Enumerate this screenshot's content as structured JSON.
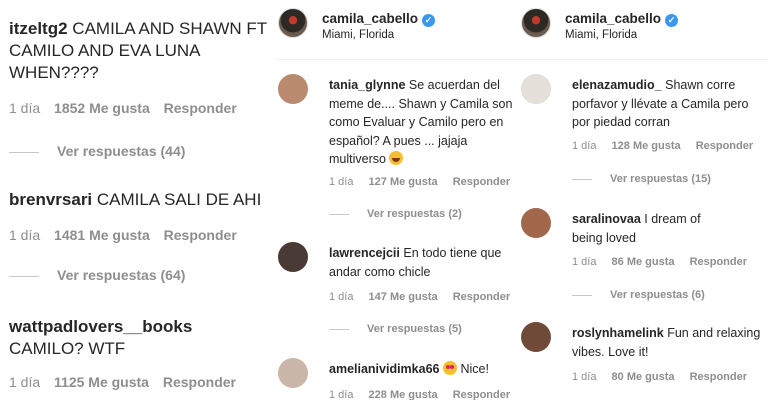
{
  "panel1": {
    "comments": [
      {
        "user": "itzeltg2",
        "text": "CAMILA AND SHAWN FT CAMILO AND EVA LUNA WHEN????",
        "time": "1 día",
        "likes": "1852 Me gusta",
        "reply": "Responder",
        "replies": "Ver respuestas (44)"
      },
      {
        "user": "brenvrsari",
        "text": "CAMILA SALI DE AHI",
        "time": "1 día",
        "likes": "1481 Me gusta",
        "reply": "Responder",
        "replies": "Ver respuestas (64)"
      },
      {
        "user": "wattpadlovers__books",
        "text": "CAMILO? WTF",
        "time": "1 día",
        "likes": "1125 Me gusta",
        "reply": "Responder"
      }
    ]
  },
  "panel2": {
    "header": {
      "name": "camila_cabello",
      "location": "Miami, Florida"
    },
    "comments": [
      {
        "user": "tania_glynne",
        "text": "Se acuerdan del meme de.... Shawn y Camila son como Evaluar y Camilo pero en español? A pues ... jajaja multiverso",
        "time": "1 día",
        "likes": "127 Me gusta",
        "reply": "Responder",
        "replies": "Ver respuestas (2)",
        "avatar_color": "#b98a6e"
      },
      {
        "user": "lawrencejcii",
        "text": "En todo tiene que andar como chicle",
        "time": "1 día",
        "likes": "147 Me gusta",
        "reply": "Responder",
        "replies": "Ver respuestas (5)",
        "avatar_color": "#4a3a35"
      },
      {
        "user": "amelianividimka66",
        "text": "Nice!",
        "time": "1 día",
        "likes": "228 Me gusta",
        "reply": "Responder",
        "avatar_color": "#c9b6a8"
      }
    ]
  },
  "panel3": {
    "header": {
      "name": "camila_cabello",
      "location": "Miami, Florida"
    },
    "comments": [
      {
        "user": "elenazamudio_",
        "text": "Shawn corre porfavor y llévate a Camila pero por piedad corran",
        "time": "1 día",
        "likes": "128 Me gusta",
        "reply": "Responder",
        "replies": "Ver respuestas (15)",
        "avatar_color": "#e6e0da"
      },
      {
        "user": "saralinovaa",
        "text": "I dream of being loved",
        "time": "1 día",
        "likes": "86 Me gusta",
        "reply": "Responder",
        "replies": "Ver respuestas (6)",
        "avatar_color": "#a0674a"
      },
      {
        "user": "roslynhamelink",
        "text": "Fun and relaxing vibes. Love it!",
        "time": "1 día",
        "likes": "80 Me gusta",
        "reply": "Responder",
        "avatar_color": "#6f4a38"
      }
    ]
  },
  "colors": {
    "verified": "#3897f0",
    "meta": "#8e8e8e",
    "text": "#262626"
  }
}
